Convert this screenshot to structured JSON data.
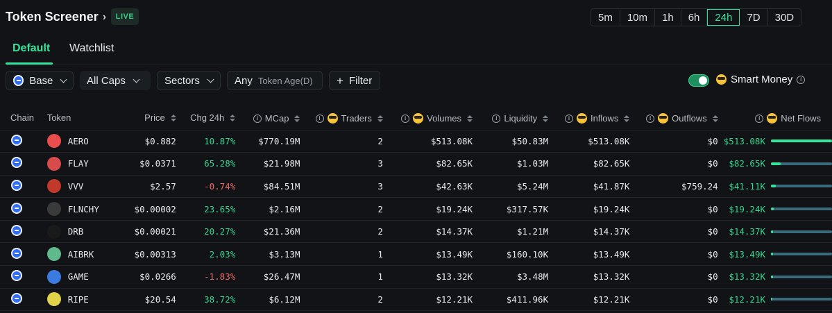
{
  "header": {
    "title": "Token Screener",
    "live_badge": "LIVE",
    "timeframes": [
      "5m",
      "10m",
      "1h",
      "6h",
      "24h",
      "7D",
      "30D"
    ],
    "active_timeframe": "24h"
  },
  "tabs": [
    "Default",
    "Watchlist"
  ],
  "active_tab": "Default",
  "filters": {
    "chain": "Base",
    "caps": "All Caps",
    "sectors": "Sectors",
    "age_value": "Any",
    "age_label": "Token Age(D)",
    "filter_button": "Filter",
    "smart_money": "Smart Money",
    "smart_money_enabled": true
  },
  "columns": {
    "chain": "Chain",
    "token": "Token",
    "price": "Price",
    "chg": "Chg 24h",
    "mcap": "MCap",
    "traders": "Traders",
    "volumes": "Volumes",
    "liquidity": "Liquidity",
    "inflows": "Inflows",
    "outflows": "Outflows",
    "netflows": "Net Flows"
  },
  "rows": [
    {
      "token": "AERO",
      "price": "$0.882",
      "chg": "10.87%",
      "chg_dir": "pos",
      "mcap": "$770.19M",
      "traders": "2",
      "volumes": "$513.08K",
      "liquidity": "$50.83M",
      "inflows": "$513.08K",
      "outflows": "$0",
      "netflows": "$513.08K",
      "flow_fraction": 1.0,
      "icon_color": "#e94d4d"
    },
    {
      "token": "FLAY",
      "price": "$0.0371",
      "chg": "65.28%",
      "chg_dir": "pos",
      "mcap": "$21.98M",
      "traders": "3",
      "volumes": "$82.65K",
      "liquidity": "$1.03M",
      "inflows": "$82.65K",
      "outflows": "$0",
      "netflows": "$82.65K",
      "flow_fraction": 0.16,
      "icon_color": "#d84b4b"
    },
    {
      "token": "VVV",
      "price": "$2.57",
      "chg": "-0.74%",
      "chg_dir": "neg",
      "mcap": "$84.51M",
      "traders": "3",
      "volumes": "$42.63K",
      "liquidity": "$5.24M",
      "inflows": "$41.87K",
      "outflows": "$759.24",
      "netflows": "$41.11K",
      "flow_fraction": 0.08,
      "icon_color": "#c0392b"
    },
    {
      "token": "FLNCHY",
      "price": "$0.00002",
      "chg": "23.65%",
      "chg_dir": "pos",
      "mcap": "$2.16M",
      "traders": "2",
      "volumes": "$19.24K",
      "liquidity": "$317.57K",
      "inflows": "$19.24K",
      "outflows": "$0",
      "netflows": "$19.24K",
      "flow_fraction": 0.04,
      "icon_color": "#3a3a3a"
    },
    {
      "token": "DRB",
      "price": "$0.00021",
      "chg": "20.27%",
      "chg_dir": "pos",
      "mcap": "$21.36M",
      "traders": "2",
      "volumes": "$14.37K",
      "liquidity": "$1.21M",
      "inflows": "$14.37K",
      "outflows": "$0",
      "netflows": "$14.37K",
      "flow_fraction": 0.03,
      "icon_color": "#1a1a1a"
    },
    {
      "token": "AIBRK",
      "price": "$0.00313",
      "chg": "2.03%",
      "chg_dir": "pos",
      "mcap": "$3.13M",
      "traders": "1",
      "volumes": "$13.49K",
      "liquidity": "$160.10K",
      "inflows": "$13.49K",
      "outflows": "$0",
      "netflows": "$13.49K",
      "flow_fraction": 0.03,
      "icon_color": "#5fb98a"
    },
    {
      "token": "GAME",
      "price": "$0.0266",
      "chg": "-1.83%",
      "chg_dir": "neg",
      "mcap": "$26.47M",
      "traders": "1",
      "volumes": "$13.32K",
      "liquidity": "$3.48M",
      "inflows": "$13.32K",
      "outflows": "$0",
      "netflows": "$13.32K",
      "flow_fraction": 0.03,
      "icon_color": "#3b7be0"
    },
    {
      "token": "RIPE",
      "price": "$20.54",
      "chg": "38.72%",
      "chg_dir": "pos",
      "mcap": "$6.12M",
      "traders": "2",
      "volumes": "$12.21K",
      "liquidity": "$411.96K",
      "inflows": "$12.21K",
      "outflows": "$0",
      "netflows": "$12.21K",
      "flow_fraction": 0.02,
      "icon_color": "#e2d24a"
    }
  ],
  "colors": {
    "accent": "#35e39b",
    "positive": "#34d58f",
    "negative": "#f06a6a",
    "background": "#111316"
  }
}
